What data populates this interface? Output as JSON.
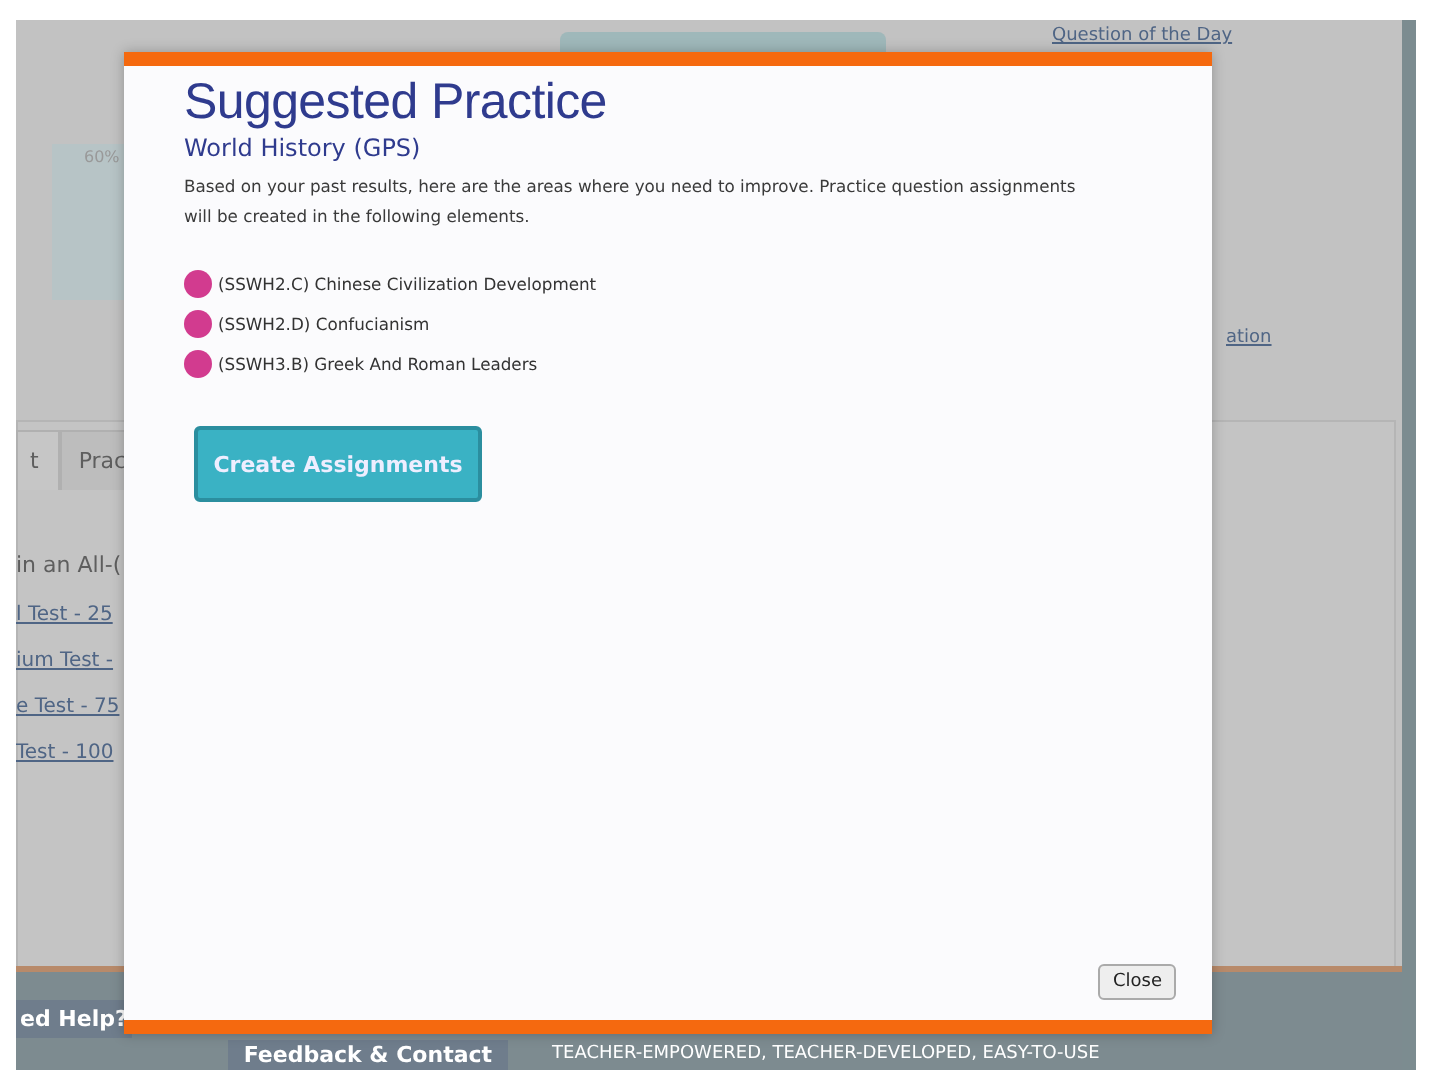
{
  "background_page": {
    "question_link": "Question of the Day",
    "chart_label": "60%",
    "side_link": "ation",
    "tabs": [
      {
        "label": "t",
        "selected": true
      },
      {
        "label": "Prac",
        "selected": false
      }
    ],
    "intro": "in an All-(",
    "test_links": [
      "l Test - 25",
      "ium Test -",
      "e Test - 75",
      "Test - 100"
    ],
    "footer": {
      "help": "ed Help?",
      "feedback": "Feedback & Contact",
      "tagline": "TEACHER-EMPOWERED, TEACHER-DEVELOPED, EASY-TO-USE"
    }
  },
  "dialog": {
    "title": "Suggested Practice",
    "subtitle": "World History (GPS)",
    "description": "Based on your past results, here are the areas where you need to improve. Practice question assignments will be created in the following elements.",
    "elements": [
      "(SSWH2.C) Chinese Civilization Development",
      "(SSWH2.D) Confucianism",
      "(SSWH3.B) Greek And Roman Leaders"
    ],
    "primary_button": "Create Assignments",
    "close_button": "Close"
  }
}
